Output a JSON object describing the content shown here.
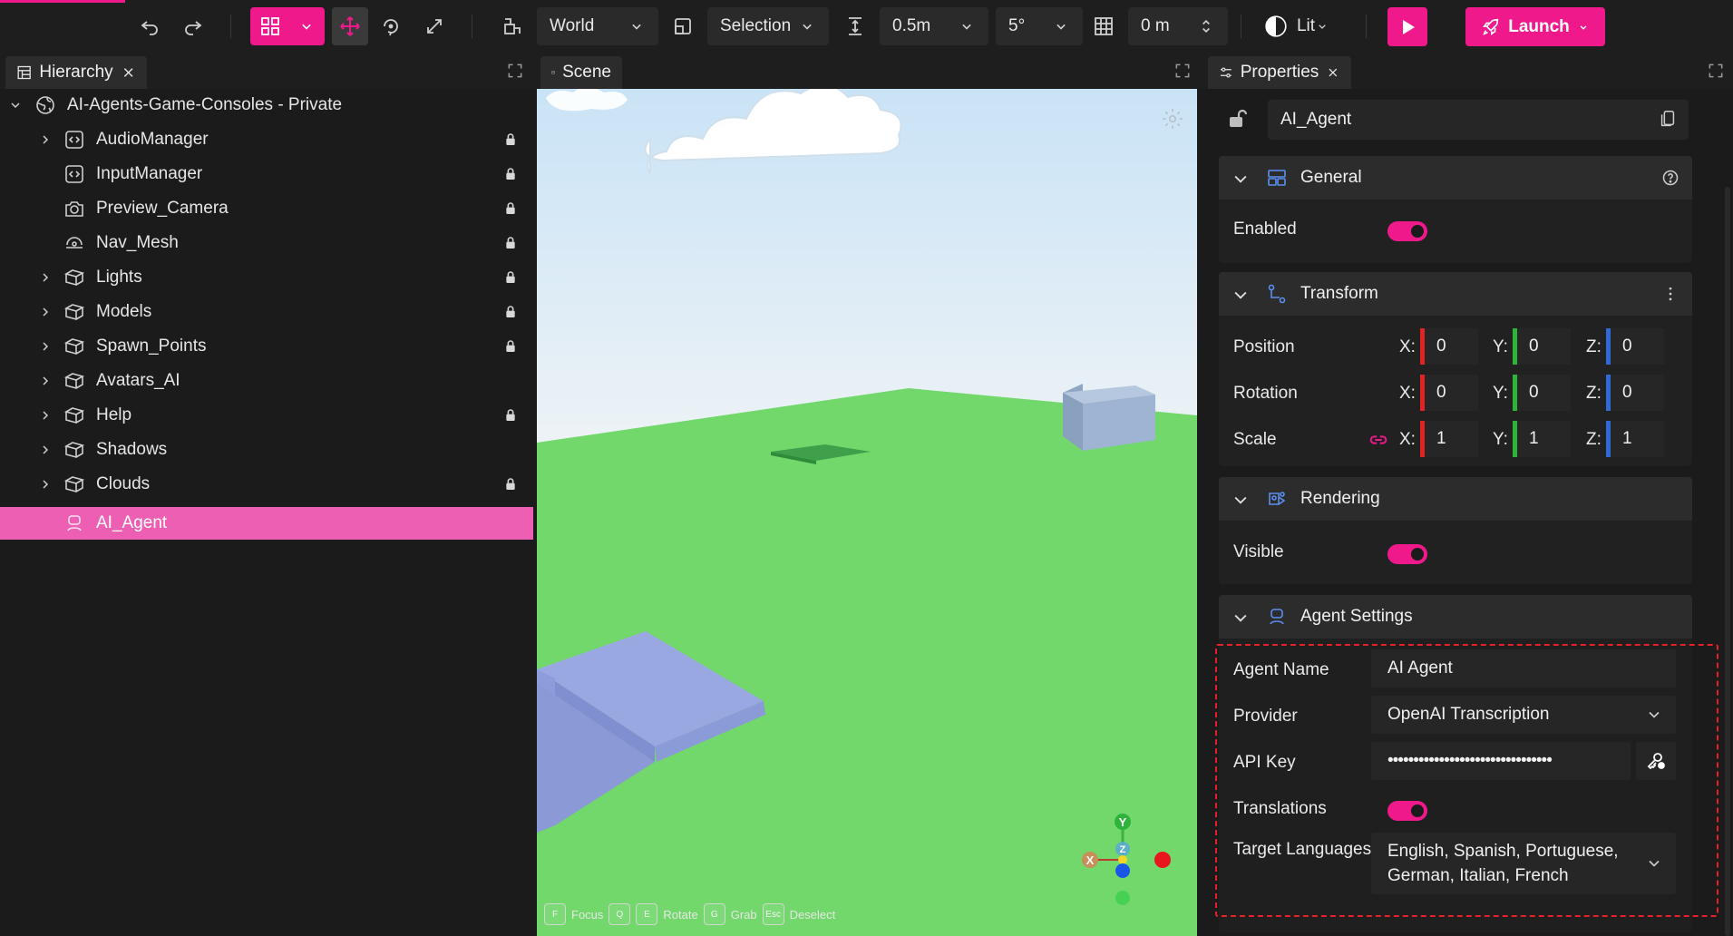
{
  "toolbar": {
    "space_label": "World",
    "selection_label": "Selection",
    "snap_distance": "0.5m",
    "snap_angle": "5°",
    "grid_value": "0 m",
    "lighting_label": "Lit",
    "launch_label": "Launch",
    "accent_color": "#f0198c"
  },
  "hierarchy": {
    "tab_label": "Hierarchy",
    "root_label": "AI-Agents-Game-Consoles - Private",
    "items": [
      {
        "label": "AudioManager",
        "icon": "code-box-icon",
        "expandable": true,
        "locked": true
      },
      {
        "label": "InputManager",
        "icon": "code-box-icon",
        "expandable": false,
        "locked": true
      },
      {
        "label": "Preview_Camera",
        "icon": "camera-icon",
        "expandable": false,
        "locked": true
      },
      {
        "label": "Nav_Mesh",
        "icon": "nav-mesh-icon",
        "expandable": false,
        "locked": true
      },
      {
        "label": "Lights",
        "icon": "cube-icon",
        "expandable": true,
        "locked": true
      },
      {
        "label": "Models",
        "icon": "cube-icon",
        "expandable": true,
        "locked": true
      },
      {
        "label": "Spawn_Points",
        "icon": "cube-icon",
        "expandable": true,
        "locked": true
      },
      {
        "label": "Avatars_AI",
        "icon": "cube-icon",
        "expandable": true,
        "locked": false
      },
      {
        "label": "Help",
        "icon": "cube-icon",
        "expandable": true,
        "locked": true
      },
      {
        "label": "Shadows",
        "icon": "cube-icon",
        "expandable": true,
        "locked": false
      },
      {
        "label": "Clouds",
        "icon": "cube-icon",
        "expandable": true,
        "locked": true
      },
      {
        "label": "AI_Agent",
        "icon": "agent-icon",
        "expandable": false,
        "locked": false,
        "selected": true
      }
    ]
  },
  "scene": {
    "tab_label": "Scene",
    "shortcuts": [
      {
        "key": "F",
        "label": "Focus"
      },
      {
        "key": "Q",
        "label": ""
      },
      {
        "key": "E",
        "label": "Rotate"
      },
      {
        "key": "G",
        "label": "Grab"
      },
      {
        "key": "Esc",
        "label": "Deselect"
      }
    ],
    "gizmo": {
      "y_label": "Y",
      "x_label": "X",
      "z_label": "Z"
    }
  },
  "properties": {
    "tab_label": "Properties",
    "object_name": "AI_Agent",
    "general": {
      "title": "General",
      "enabled_label": "Enabled",
      "enabled": true
    },
    "transform": {
      "title": "Transform",
      "rows": [
        {
          "label": "Position",
          "x": "0",
          "y": "0",
          "z": "0"
        },
        {
          "label": "Rotation",
          "x": "0",
          "y": "0",
          "z": "0"
        },
        {
          "label": "Scale",
          "x": "1",
          "y": "1",
          "z": "1"
        }
      ],
      "axis_x": "X:",
      "axis_y": "Y:",
      "axis_z": "Z:"
    },
    "rendering": {
      "title": "Rendering",
      "visible_label": "Visible",
      "visible": true
    },
    "agent_settings": {
      "title": "Agent Settings",
      "agent_name_label": "Agent Name",
      "agent_name_value": "AI Agent",
      "provider_label": "Provider",
      "provider_value": "OpenAI Transcription",
      "api_key_label": "API Key",
      "api_key_value": "••••••••••••••••••••••••••••••••",
      "translations_label": "Translations",
      "translations": true,
      "target_languages_label": "Target Languages",
      "target_languages_line1": "English, Spanish, Portuguese,",
      "target_languages_line2": "German, Italian, French"
    }
  }
}
